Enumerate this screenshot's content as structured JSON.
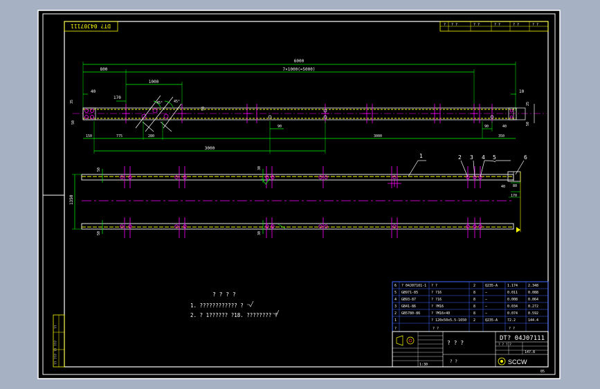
{
  "drawing": {
    "rotated_title": "DT? 04J07111",
    "dims": {
      "overall": "6000",
      "d800": "800",
      "spacing": "7×1000(=5000)",
      "d1000": "1000",
      "d40": "40",
      "d170": "170",
      "d10": "10",
      "a45a": "45°",
      "a45b": "45°",
      "d50a": "50",
      "d50b": "50",
      "d50c": "50",
      "d90a": "90",
      "d90b": "90",
      "d40b": "40",
      "d150": "150",
      "d775": "775",
      "d280": "280",
      "d3000a": "3000",
      "d3000b": "3000",
      "d350": "350",
      "d1350": "1350",
      "d80": "80",
      "d40c": "40",
      "d170b": "170",
      "s50a": "50",
      "s50b": "50",
      "s30a": "30",
      "s30b": "30",
      "d25": "25",
      "d35": "35"
    },
    "balloons": [
      "1",
      "2",
      "3",
      "4",
      "5",
      "6"
    ],
    "notes": {
      "title": "? ? ? ?",
      "line1": "1. ???????????? ?",
      "line2": "2. ? 1?????? ?18. ???????? ?"
    },
    "side_box": [
      "??",
      "???",
      "?? ??? ??"
    ]
  },
  "bom": {
    "rows": [
      {
        "no": "6",
        "code": "? 04J07101-1",
        "name": "? ?",
        "qty": "2",
        "mat": "Q235-A",
        "w1": "1.174",
        "w2": "2.348"
      },
      {
        "no": "5",
        "code": "GB971-85",
        "name": "? ?16",
        "qty": "8",
        "mat": "—",
        "w1": "0.011",
        "w2": "0.088"
      },
      {
        "no": "4",
        "code": "GB93-87",
        "name": "? ?16",
        "qty": "8",
        "mat": "—",
        "w1": "0.008",
        "w2": "0.064"
      },
      {
        "no": "3",
        "code": "GB41-86",
        "name": "? ?M16",
        "qty": "8",
        "mat": "—",
        "w1": "0.034",
        "w2": "0.272"
      },
      {
        "no": "2",
        "code": "GB5780-86",
        "name": "? ?M16×40",
        "qty": "8",
        "mat": "—",
        "w1": "0.074",
        "w2": "0.592"
      },
      {
        "no": "1",
        "code": "",
        "name": "? 120x50x5.5-1650",
        "qty": "2",
        "mat": "Q235-A",
        "w1": "72.2",
        "w2": "144.4"
      }
    ],
    "header": {
      "c1": "?",
      "c2": "? ?",
      "c3": "? ?"
    }
  },
  "title_block": {
    "name": "? ? ?",
    "drawing_no": "DT? 04J07111",
    "mass": "147.8",
    "company": "SCCW",
    "scale": "1:30",
    "tiny": "? ? ? ?",
    "tiny2": "? ?",
    "corner": "05"
  },
  "top_mini": [
    "?",
    "? ?",
    "? ?",
    "? ?",
    "? ?",
    "? ?"
  ]
}
